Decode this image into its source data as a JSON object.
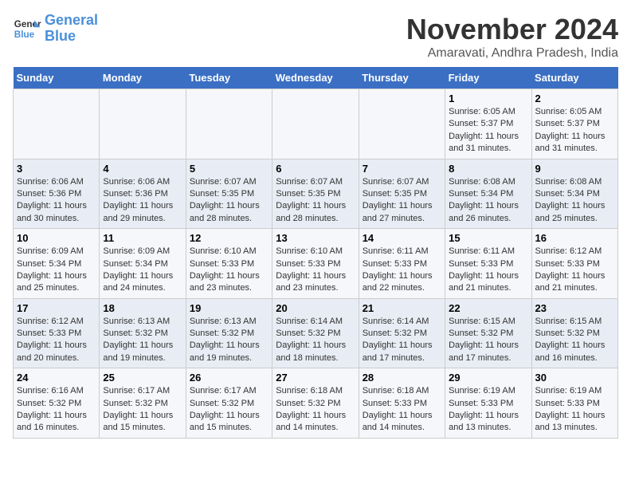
{
  "logo": {
    "line1": "General",
    "line2": "Blue"
  },
  "title": "November 2024",
  "subtitle": "Amaravati, Andhra Pradesh, India",
  "days_of_week": [
    "Sunday",
    "Monday",
    "Tuesday",
    "Wednesday",
    "Thursday",
    "Friday",
    "Saturday"
  ],
  "weeks": [
    [
      {
        "day": "",
        "info": ""
      },
      {
        "day": "",
        "info": ""
      },
      {
        "day": "",
        "info": ""
      },
      {
        "day": "",
        "info": ""
      },
      {
        "day": "",
        "info": ""
      },
      {
        "day": "1",
        "info": "Sunrise: 6:05 AM\nSunset: 5:37 PM\nDaylight: 11 hours and 31 minutes."
      },
      {
        "day": "2",
        "info": "Sunrise: 6:05 AM\nSunset: 5:37 PM\nDaylight: 11 hours and 31 minutes."
      }
    ],
    [
      {
        "day": "3",
        "info": "Sunrise: 6:06 AM\nSunset: 5:36 PM\nDaylight: 11 hours and 30 minutes."
      },
      {
        "day": "4",
        "info": "Sunrise: 6:06 AM\nSunset: 5:36 PM\nDaylight: 11 hours and 29 minutes."
      },
      {
        "day": "5",
        "info": "Sunrise: 6:07 AM\nSunset: 5:35 PM\nDaylight: 11 hours and 28 minutes."
      },
      {
        "day": "6",
        "info": "Sunrise: 6:07 AM\nSunset: 5:35 PM\nDaylight: 11 hours and 28 minutes."
      },
      {
        "day": "7",
        "info": "Sunrise: 6:07 AM\nSunset: 5:35 PM\nDaylight: 11 hours and 27 minutes."
      },
      {
        "day": "8",
        "info": "Sunrise: 6:08 AM\nSunset: 5:34 PM\nDaylight: 11 hours and 26 minutes."
      },
      {
        "day": "9",
        "info": "Sunrise: 6:08 AM\nSunset: 5:34 PM\nDaylight: 11 hours and 25 minutes."
      }
    ],
    [
      {
        "day": "10",
        "info": "Sunrise: 6:09 AM\nSunset: 5:34 PM\nDaylight: 11 hours and 25 minutes."
      },
      {
        "day": "11",
        "info": "Sunrise: 6:09 AM\nSunset: 5:34 PM\nDaylight: 11 hours and 24 minutes."
      },
      {
        "day": "12",
        "info": "Sunrise: 6:10 AM\nSunset: 5:33 PM\nDaylight: 11 hours and 23 minutes."
      },
      {
        "day": "13",
        "info": "Sunrise: 6:10 AM\nSunset: 5:33 PM\nDaylight: 11 hours and 23 minutes."
      },
      {
        "day": "14",
        "info": "Sunrise: 6:11 AM\nSunset: 5:33 PM\nDaylight: 11 hours and 22 minutes."
      },
      {
        "day": "15",
        "info": "Sunrise: 6:11 AM\nSunset: 5:33 PM\nDaylight: 11 hours and 21 minutes."
      },
      {
        "day": "16",
        "info": "Sunrise: 6:12 AM\nSunset: 5:33 PM\nDaylight: 11 hours and 21 minutes."
      }
    ],
    [
      {
        "day": "17",
        "info": "Sunrise: 6:12 AM\nSunset: 5:33 PM\nDaylight: 11 hours and 20 minutes."
      },
      {
        "day": "18",
        "info": "Sunrise: 6:13 AM\nSunset: 5:32 PM\nDaylight: 11 hours and 19 minutes."
      },
      {
        "day": "19",
        "info": "Sunrise: 6:13 AM\nSunset: 5:32 PM\nDaylight: 11 hours and 19 minutes."
      },
      {
        "day": "20",
        "info": "Sunrise: 6:14 AM\nSunset: 5:32 PM\nDaylight: 11 hours and 18 minutes."
      },
      {
        "day": "21",
        "info": "Sunrise: 6:14 AM\nSunset: 5:32 PM\nDaylight: 11 hours and 17 minutes."
      },
      {
        "day": "22",
        "info": "Sunrise: 6:15 AM\nSunset: 5:32 PM\nDaylight: 11 hours and 17 minutes."
      },
      {
        "day": "23",
        "info": "Sunrise: 6:15 AM\nSunset: 5:32 PM\nDaylight: 11 hours and 16 minutes."
      }
    ],
    [
      {
        "day": "24",
        "info": "Sunrise: 6:16 AM\nSunset: 5:32 PM\nDaylight: 11 hours and 16 minutes."
      },
      {
        "day": "25",
        "info": "Sunrise: 6:17 AM\nSunset: 5:32 PM\nDaylight: 11 hours and 15 minutes."
      },
      {
        "day": "26",
        "info": "Sunrise: 6:17 AM\nSunset: 5:32 PM\nDaylight: 11 hours and 15 minutes."
      },
      {
        "day": "27",
        "info": "Sunrise: 6:18 AM\nSunset: 5:32 PM\nDaylight: 11 hours and 14 minutes."
      },
      {
        "day": "28",
        "info": "Sunrise: 6:18 AM\nSunset: 5:33 PM\nDaylight: 11 hours and 14 minutes."
      },
      {
        "day": "29",
        "info": "Sunrise: 6:19 AM\nSunset: 5:33 PM\nDaylight: 11 hours and 13 minutes."
      },
      {
        "day": "30",
        "info": "Sunrise: 6:19 AM\nSunset: 5:33 PM\nDaylight: 11 hours and 13 minutes."
      }
    ]
  ]
}
